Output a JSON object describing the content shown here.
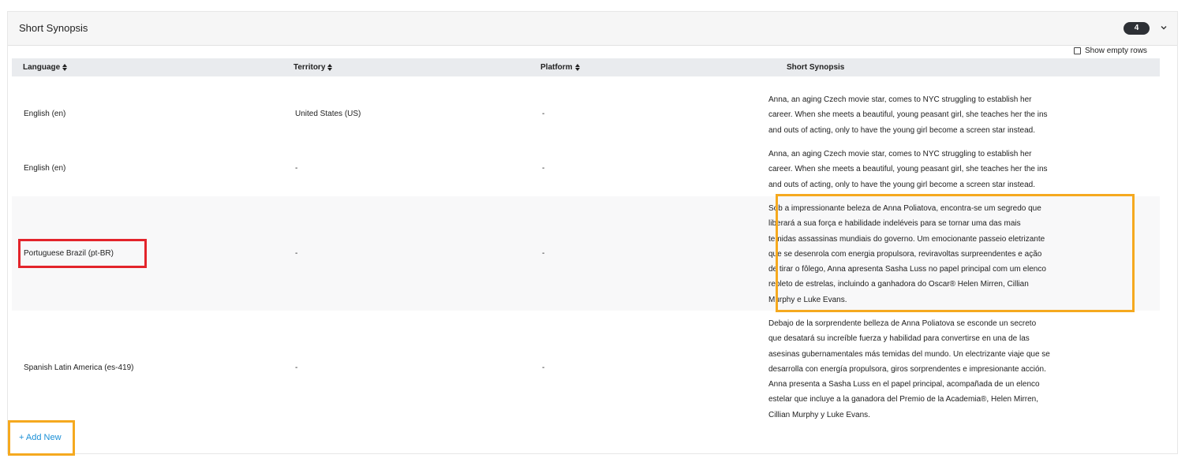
{
  "section": {
    "title": "Short Synopsis",
    "count": "4",
    "show_empty_rows_label": "Show empty rows"
  },
  "table": {
    "headers": [
      "Language",
      "Territory",
      "Platform",
      "Short Synopsis"
    ],
    "rows": [
      {
        "language": "English (en)",
        "territory": "United States (US)",
        "platform": "-",
        "synopsis": "Anna, an aging Czech movie star, comes to NYC struggling to establish her\ncareer. When she meets a beautiful, young peasant girl, she teaches her the ins\nand outs of acting, only to have the young girl become a screen star instead."
      },
      {
        "language": "English (en)",
        "territory": "-",
        "platform": "-",
        "synopsis": "Anna, an aging Czech movie star, comes to NYC struggling to establish her\ncareer. When she meets a beautiful, young peasant girl, she teaches her the ins\nand outs of acting, only to have the young girl become a screen star instead."
      },
      {
        "language": "Portuguese Brazil (pt-BR)",
        "territory": "-",
        "platform": "-",
        "synopsis": "Sob a impressionante beleza de Anna Poliatova, encontra-se um segredo que\nliberará a sua força e habilidade indeléveis para se tornar uma das mais\ntemidas assassinas mundiais do governo. Um emocionante passeio eletrizante\nque se desenrola com energia propulsora, reviravoltas surpreendentes e ação\nde tirar o fôlego, Anna apresenta Sasha Luss no papel principal com um elenco\nrepleto de estrelas, incluindo a ganhadora do Oscar® Helen Mirren, Cillian\nMurphy e Luke Evans."
      },
      {
        "language": "Spanish Latin America (es-419)",
        "territory": "-",
        "platform": "-",
        "synopsis": "Debajo de la sorprendente belleza de Anna Poliatova se esconde un secreto\nque desatará su increíble fuerza y habilidad para convertirse en una de las\nasesinas gubernamentales más temidas del mundo. Un electrizante viaje que se\ndesarrolla con energía propulsora, giros sorprendentes e impresionante acción.\nAnna presenta a Sasha Luss en el papel principal, acompañada de un elenco\nestelar que incluye a la ganadora del Premio de la Academia®, Helen Mirren,\nCillian Murphy y Luke Evans."
      }
    ]
  },
  "actions": {
    "add_new_label": "+ Add New"
  },
  "icons": {
    "collapse": "chevron-down-icon",
    "sort": "sort-icon"
  },
  "colors": {
    "highlight_red": "#e3242b",
    "highlight_orange": "#f5a91f",
    "link": "#1a8fd6"
  }
}
